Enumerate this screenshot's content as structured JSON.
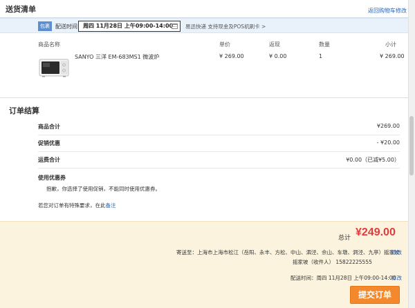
{
  "section1": {
    "title": "送货清单",
    "back_link": "返回购物车修改",
    "package_badge": "包裹",
    "delivery_label": "配送时间",
    "delivery_value": "周四 11月28日 上午09:00-14:00",
    "delivery_note": "易迅快递 支持现金及POS机刷卡 >"
  },
  "table": {
    "headers": {
      "name": "商品名称",
      "price": "单价",
      "rebate": "返现",
      "qty": "数量",
      "subtotal": "小计"
    },
    "rows": [
      {
        "name": "SANYO 三洋 EM-683MS1 微波炉",
        "price": "¥ 269.00",
        "rebate": "¥ 0.00",
        "qty": "1",
        "subtotal": "¥ 269.00"
      }
    ]
  },
  "section2": {
    "title": "订单结算",
    "goods_total_label": "商品合计",
    "goods_total_value": "¥269.00",
    "promo_label": "促销优惠",
    "promo_value": "- ¥20.00",
    "shipping_label": "运费合计",
    "shipping_value": "¥0.00（已减¥5.00）",
    "coupon_label": "使用优惠券",
    "coupon_msg": "抱歉，你选择了使用促销，不能同时使用优惠券。",
    "remark_prefix": "若您对订单有特殊要求，在此",
    "remark_link": "备注"
  },
  "summary": {
    "total_label": "总计",
    "total_value": "¥249.00",
    "address": "寄送至：上海市上海市松江（岳阳、永丰、方松、中山、泗泾、佘山、车墩、洞泾、九亭）摇家坡",
    "address_edit": "修改",
    "contact": "摇家坡（收件人） 15822225555",
    "delivery_time": "配送时间：周四 11月28日 上午09:00-14:00",
    "time_edit": "修改",
    "submit": "提交订单"
  },
  "colors": {
    "accent": "#e4393c",
    "button": "#f3882c",
    "link": "#2a64b4",
    "panel": "#fcf3de"
  }
}
